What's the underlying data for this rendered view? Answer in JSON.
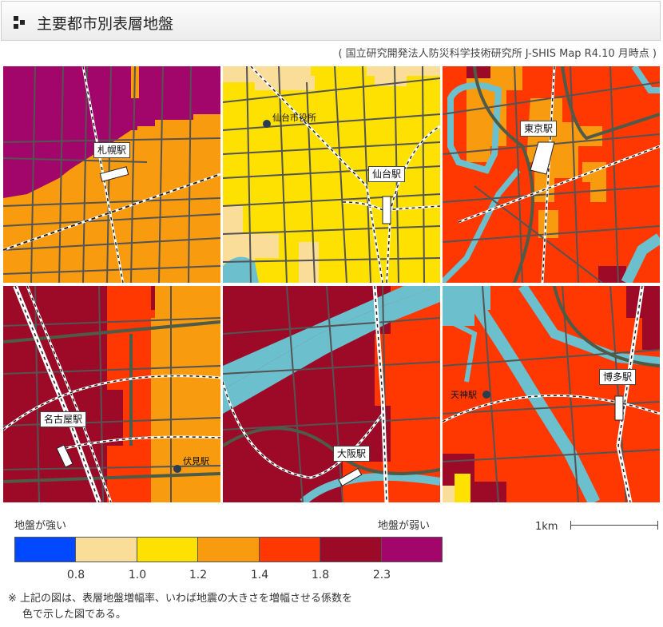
{
  "header": {
    "title": "主要都市別表層地盤"
  },
  "source": "( 国立研究開発法人防災科学技術研究所 J-SHIS Map  R4.10 月時点 )",
  "colors": {
    "magenta": "#a3066a",
    "orange": "#f89b0e",
    "yellow": "#ffe100",
    "pale": "#f9dd99",
    "red": "#fe3800",
    "dark_red": "#9c0a27",
    "blue": "#0049ff",
    "water": "#6cc0cd",
    "road": "#545454",
    "highway": "#4d5b48"
  },
  "maps": {
    "sapporo": {
      "station": "札幌駅"
    },
    "sendai": {
      "station": "仙台駅",
      "city_hall": "仙台市役所"
    },
    "tokyo": {
      "station": "東京駅"
    },
    "nagoya": {
      "station": "名古屋駅",
      "sub": "伏見駅"
    },
    "osaka": {
      "station": "大阪駅"
    },
    "fukuoka": {
      "station": "博多駅",
      "sub": "天神駅"
    }
  },
  "legend": {
    "strong": "地盤が強い",
    "weak": "地盤が弱い",
    "scale": "1km",
    "ticks": [
      "0.8",
      "1.0",
      "1.2",
      "1.4",
      "1.8",
      "2.3"
    ],
    "colors": [
      "#0049ff",
      "#f9dd99",
      "#ffe100",
      "#f89b0e",
      "#fe3800",
      "#9c0a27",
      "#a3066a"
    ]
  },
  "note": {
    "line1": "※ 上記の図は、表層地盤増幅率、いわば地震の大きさを増幅させる係数を",
    "line2": "色で示した図である。"
  }
}
